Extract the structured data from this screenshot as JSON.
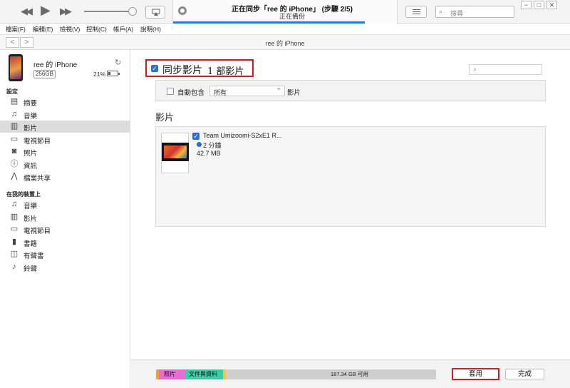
{
  "toolbar": {
    "prev_icon": "◀◀",
    "play_icon": "▶",
    "next_icon": "▶▶",
    "now_playing_title": "正在同步「ree 的 iPhone」 (步驟 2/5)",
    "now_playing_subtitle": "正在備份",
    "progress": 0.85,
    "search_placeholder": "搜尋",
    "window_controls": [
      "−",
      "□",
      "✕"
    ]
  },
  "menu": [
    "檔案(F)",
    "編輯(E)",
    "檢視(V)",
    "控制(C)",
    "帳戶(A)",
    "說明(H)"
  ],
  "nav": {
    "back": "<",
    "forward": ">",
    "device_title": "ree 的 iPhone"
  },
  "device": {
    "name": "ree 的 iPhone",
    "capacity": "256GB",
    "battery": "21%",
    "battery_level": 0.21
  },
  "sidebar": {
    "settings_label": "設定",
    "settings_items": [
      {
        "label": "摘要",
        "icon": "summary-icon",
        "glyph": "▤"
      },
      {
        "label": "音樂",
        "icon": "music-icon",
        "glyph": "♫"
      },
      {
        "label": "影片",
        "icon": "film-icon",
        "glyph": "▥",
        "selected": true
      },
      {
        "label": "電視節目",
        "icon": "tv-icon",
        "glyph": "▭"
      },
      {
        "label": "照片",
        "icon": "camera-icon",
        "glyph": "◙"
      },
      {
        "label": "資訊",
        "icon": "info-icon",
        "glyph": "ⓘ"
      },
      {
        "label": "檔案共享",
        "icon": "share-icon",
        "glyph": "⋀"
      }
    ],
    "on_device_label": "在我的裝置上",
    "device_items": [
      {
        "label": "音樂",
        "icon": "music-icon",
        "glyph": "♫"
      },
      {
        "label": "影片",
        "icon": "film-icon",
        "glyph": "▥"
      },
      {
        "label": "電視節目",
        "icon": "tv-icon",
        "glyph": "▭"
      },
      {
        "label": "書籍",
        "icon": "book-icon",
        "glyph": "▮"
      },
      {
        "label": "有聲書",
        "icon": "audiobook-icon",
        "glyph": "◫"
      },
      {
        "label": "鈴聲",
        "icon": "bell-icon",
        "glyph": "♪"
      }
    ]
  },
  "main": {
    "sync_checkbox_mark": "✓",
    "sync_title": "同步影片",
    "sync_count": "1 部影片",
    "auto_include_label": "自動包含",
    "auto_include_value": "所有",
    "auto_include_suffix": "影片",
    "movies_heading": "影片",
    "movie": {
      "title": "Team Umizoomi-S2xE1 R...",
      "duration": "2 分鐘",
      "size": "42.7 MB"
    }
  },
  "bottom": {
    "segments": [
      {
        "label": "",
        "color": "#f0a030"
      },
      {
        "label": "照片",
        "color": "#e86bd8"
      },
      {
        "label": "文件與資料",
        "color": "#3ec9a7"
      },
      {
        "label": "",
        "color": "#f5c24a"
      }
    ],
    "free_text": "187.34 GB 可用",
    "apply_label": "套用",
    "done_label": "完成"
  }
}
